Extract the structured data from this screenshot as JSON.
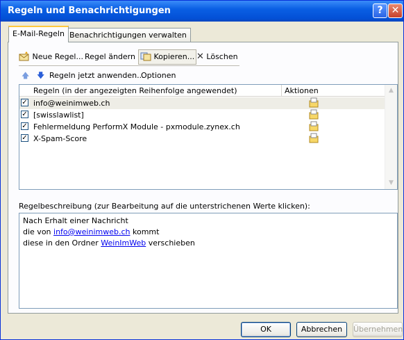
{
  "window": {
    "title": "Regeln und Benachrichtigungen",
    "help_glyph": "?",
    "close_glyph": "✕"
  },
  "tabs": [
    {
      "label": "E-Mail-Regeln",
      "active": true
    },
    {
      "label": "Benachrichtigungen verwalten",
      "active": false
    }
  ],
  "toolbar": {
    "new_rule": "Neue Regel...",
    "change_rule": "Regel ändern",
    "copy": "Kopieren...",
    "delete": "Löschen"
  },
  "secondary": {
    "apply_now": "Regeln jetzt anwenden...",
    "options": "Optionen"
  },
  "rules_list": {
    "col_rules": "Regeln (in der angezeigten Reihenfolge angewendet)",
    "col_actions": "Aktionen",
    "rows": [
      {
        "name": "info@weinimweb.ch",
        "checked": true,
        "selected": true
      },
      {
        "name": "[swisslawlist]",
        "checked": true,
        "selected": false
      },
      {
        "name": "Fehlermeldung PerformX Module - pxmodule.zynex.ch",
        "checked": true,
        "selected": false
      },
      {
        "name": "X-Spam-Score",
        "checked": true,
        "selected": false
      }
    ]
  },
  "description": {
    "label": "Regelbeschreibung (zur Bearbeitung auf die unterstrichenen Werte klicken):",
    "line1": "Nach Erhalt einer Nachricht",
    "line2_prefix": "die von ",
    "line2_link": "info@weinimweb.ch",
    "line2_suffix": " kommt",
    "line3_prefix": "diese in den Ordner ",
    "line3_link": "WeinImWeb",
    "line3_suffix": " verschieben"
  },
  "buttons": {
    "ok": "OK",
    "cancel": "Abbrechen",
    "apply": "Übernehmen"
  },
  "colors": {
    "titlebar": "#0a5fe4",
    "link": "#0000ee",
    "selected_row": "#eeede6"
  }
}
